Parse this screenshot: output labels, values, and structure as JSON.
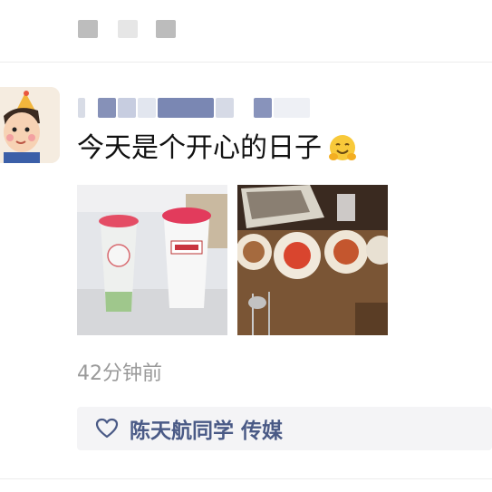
{
  "post": {
    "text": "今天是个开心的日子",
    "emoji": "hugging-face-emoji",
    "timestamp": "42分钟前",
    "photos": [
      "milk-tea-cups-photo",
      "korean-dinner-table-photo"
    ]
  },
  "likes": {
    "names": "陈天航同学 传媒"
  },
  "colors": {
    "like_text": "#4a5a86",
    "timestamp": "#9a9a9a",
    "like_bar_bg": "#f4f4f6"
  }
}
